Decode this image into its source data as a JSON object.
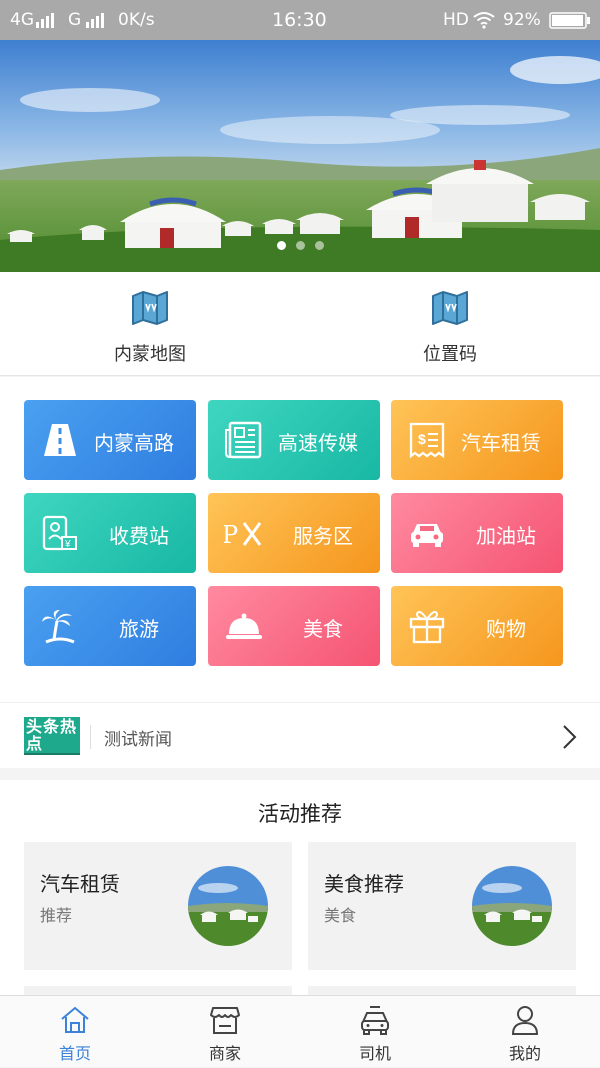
{
  "status_bar": {
    "network": "4G",
    "network2": "G",
    "speed": "0K/s",
    "time": "16:30",
    "hd": "HD",
    "battery": "92%"
  },
  "banner": {
    "dots": 3,
    "active_dot": 0
  },
  "quick_links": [
    {
      "label": "内蒙地图",
      "icon": "map-icon"
    },
    {
      "label": "位置码",
      "icon": "map-icon"
    }
  ],
  "services": [
    {
      "label": "内蒙高路",
      "icon": "road-icon",
      "grad": [
        "#4aa0f0",
        "#2f7ee0"
      ]
    },
    {
      "label": "高速传媒",
      "icon": "newspaper-icon",
      "grad": [
        "#3fd6c0",
        "#18b8a4"
      ]
    },
    {
      "label": "汽车租赁",
      "icon": "receipt-icon",
      "grad": [
        "#ffc457",
        "#f5961e"
      ]
    },
    {
      "label": "收费站",
      "icon": "toll-icon",
      "grad": [
        "#3fd6c0",
        "#18b8a4"
      ]
    },
    {
      "label": "服务区",
      "icon": "service-area-icon",
      "grad": [
        "#ffc457",
        "#f5961e"
      ]
    },
    {
      "label": "加油站",
      "icon": "car-icon",
      "grad": [
        "#ff8aa0",
        "#f55472"
      ]
    },
    {
      "label": "旅游",
      "icon": "palm-tree-icon",
      "grad": [
        "#4aa0f0",
        "#2f7ee0"
      ]
    },
    {
      "label": "美食",
      "icon": "cloche-icon",
      "grad": [
        "#ff8aa0",
        "#f55472"
      ]
    },
    {
      "label": "购物",
      "icon": "gift-icon",
      "grad": [
        "#ffc457",
        "#f5961e"
      ]
    }
  ],
  "news": {
    "logo_text": "头条热点",
    "headline": "测试新闻"
  },
  "activities": {
    "title": "活动推荐",
    "cards": [
      {
        "title": "汽车租赁",
        "subtitle": "推荐"
      },
      {
        "title": "美食推荐",
        "subtitle": "美食"
      }
    ]
  },
  "tabs": [
    {
      "label": "首页",
      "icon": "home-icon",
      "active": true
    },
    {
      "label": "商家",
      "icon": "shop-icon",
      "active": false
    },
    {
      "label": "司机",
      "icon": "car-icon",
      "active": false
    },
    {
      "label": "我的",
      "icon": "user-icon",
      "active": false
    }
  ],
  "colors": {
    "accent": "#3b83d8"
  }
}
